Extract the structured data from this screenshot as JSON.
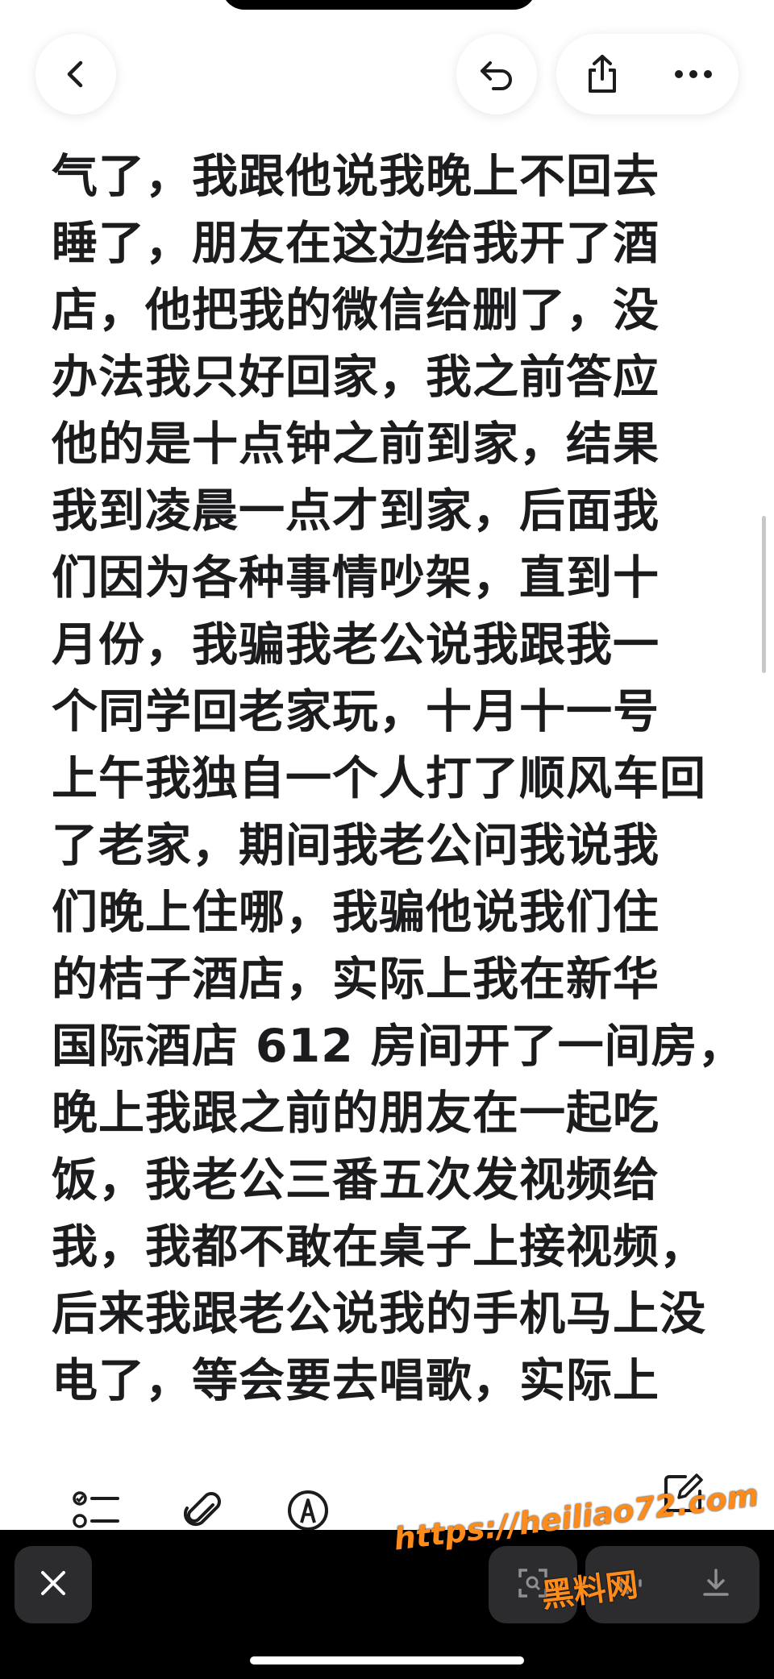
{
  "header": {
    "icons": [
      "back-icon",
      "undo-icon",
      "share-icon",
      "more-icon"
    ]
  },
  "note": {
    "lines": [
      "气了，我跟他说我晚上不回去",
      "睡了，朋友在这边给我开了酒",
      "店，他把我的微信给删了，没",
      "办法我只好回家，我之前答应",
      "他的是十点钟之前到家，结果",
      "我到凌晨一点才到家，后面我",
      "们因为各种事情吵架，直到十",
      "月份，我骗我老公说我跟我一",
      "个同学回老家玩，十月十一号",
      "上午我独自一个人打了顺风车回",
      "了老家，期间我老公问我说我",
      "们晚上住哪，我骗他说我们住",
      "的桔子酒店，实际上我在新华",
      "国际酒店 612 房间开了一间房，",
      "晚上我跟之前的朋友在一起吃",
      "饭，我老公三番五次发视频给",
      "我，我都不敢在桌子上接视频，",
      "后来我跟老公说我的手机马上没",
      "电了，等会要去唱歌，实际上"
    ]
  },
  "toolbar": {
    "icons": [
      "checklist-icon",
      "attachment-icon",
      "pen-markup-icon",
      "compose-icon"
    ]
  },
  "bottom_bar": {
    "icons": [
      "close-icon",
      "scan-icon",
      "audio-icon",
      "download-icon"
    ]
  },
  "watermark": {
    "url": "https://heiliao72.com",
    "name": "黑料网",
    "color": "#ff8c1a"
  }
}
